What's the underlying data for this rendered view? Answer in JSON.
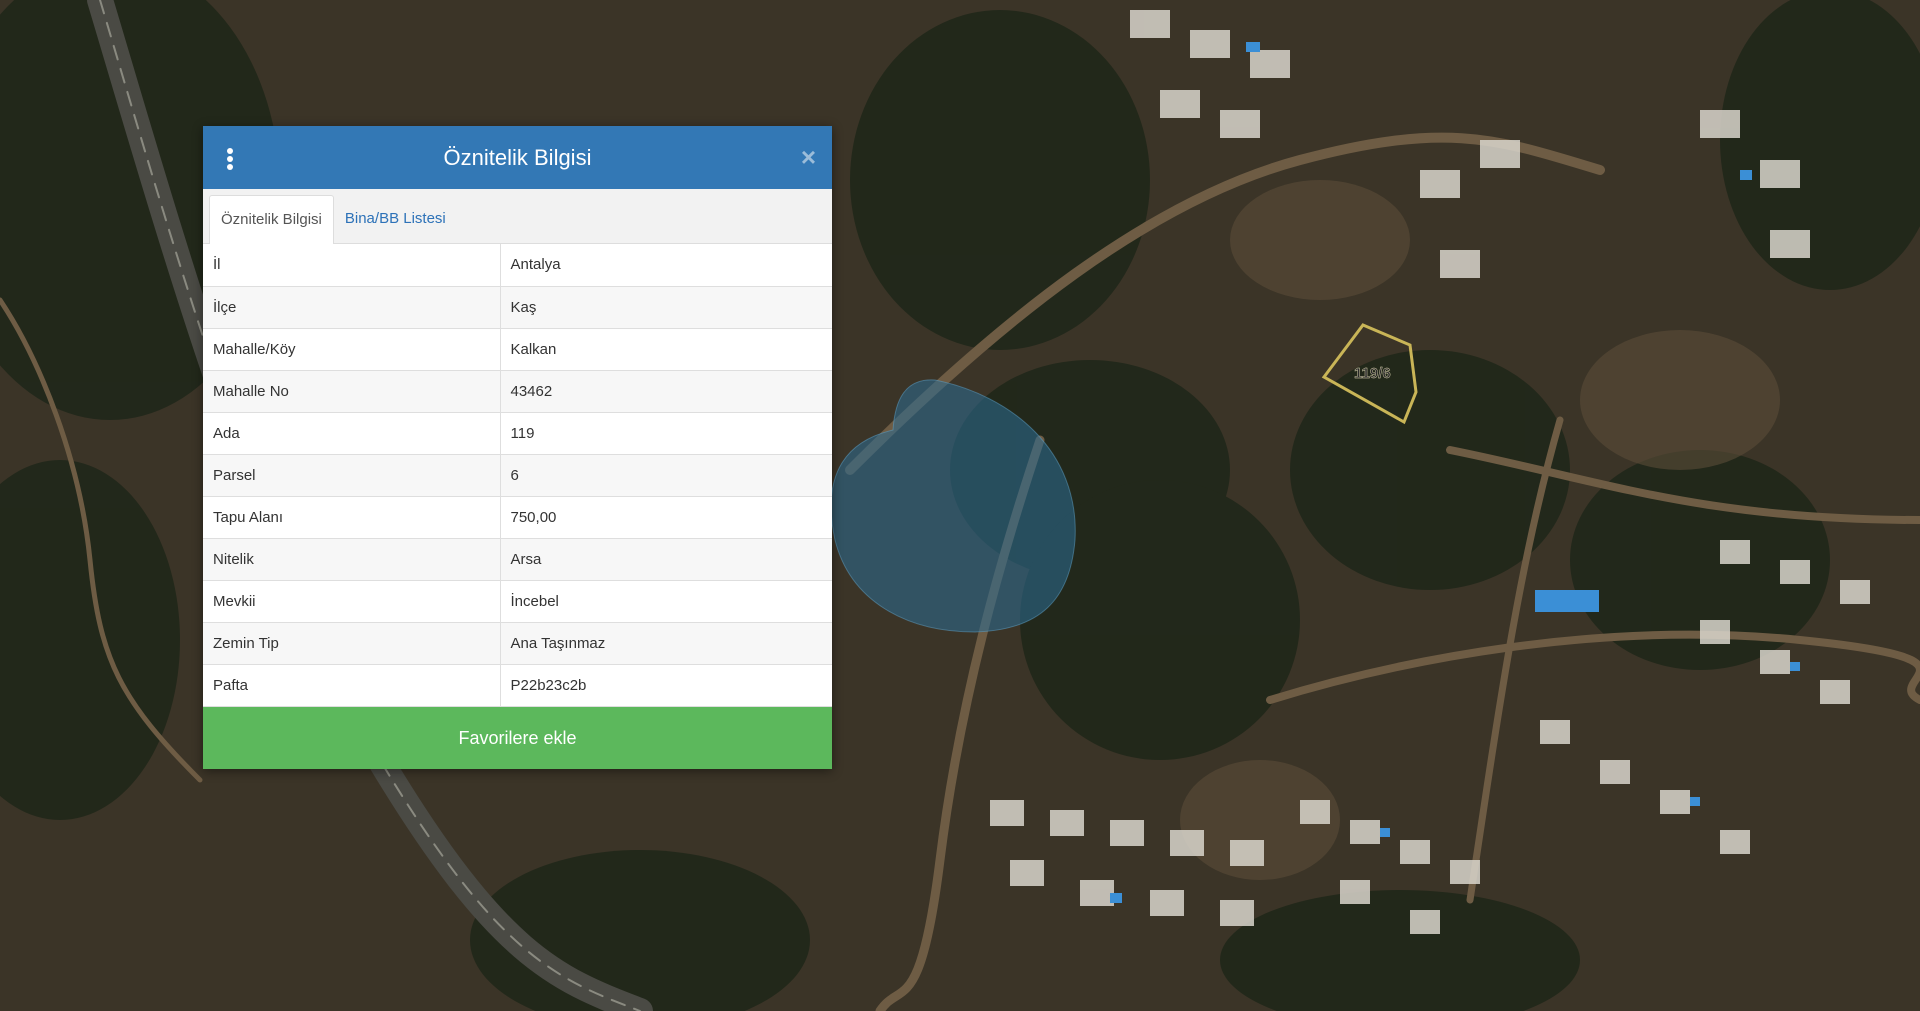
{
  "map": {
    "parcel_label": "119/6",
    "colors": {
      "terrain": "#3a3426",
      "vegetation": "#1f2719",
      "road": "#6e5c44",
      "parcel_outline": "#c9b557",
      "accuracy_circle": "#2b6e95"
    }
  },
  "panel": {
    "title": "Öznitelik Bilgisi",
    "menu_icon": "vertical-dots-icon",
    "close_icon": "close-icon",
    "close_glyph": "×",
    "header_color": "#3378b5",
    "tabs": [
      {
        "label": "Öznitelik Bilgisi",
        "active": true
      },
      {
        "label": "Bina/BB Listesi",
        "active": false
      }
    ],
    "rows": [
      {
        "key": "İl",
        "value": "Antalya"
      },
      {
        "key": "İlçe",
        "value": "Kaş"
      },
      {
        "key": "Mahalle/Köy",
        "value": "Kalkan"
      },
      {
        "key": "Mahalle No",
        "value": "43462"
      },
      {
        "key": "Ada",
        "value": "119"
      },
      {
        "key": "Parsel",
        "value": "6"
      },
      {
        "key": "Tapu Alanı",
        "value": "750,00"
      },
      {
        "key": "Nitelik",
        "value": "Arsa"
      },
      {
        "key": "Mevkii",
        "value": "İncebel"
      },
      {
        "key": "Zemin Tip",
        "value": "Ana Taşınmaz"
      },
      {
        "key": "Pafta",
        "value": "P22b23c2b"
      }
    ],
    "favorite_button": "Favorilere ekle",
    "button_color": "#5cb85c"
  }
}
